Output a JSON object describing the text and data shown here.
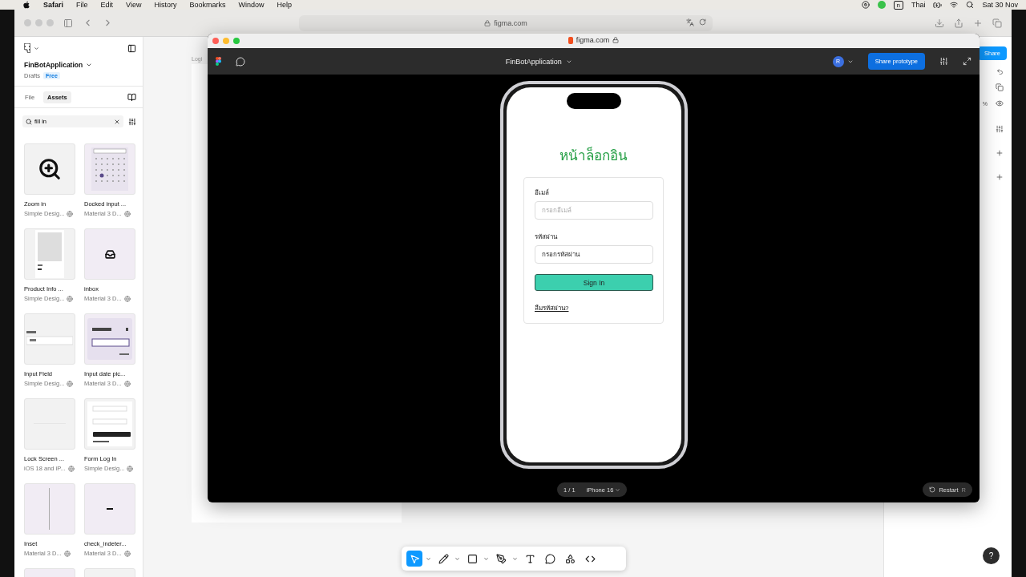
{
  "menubar": {
    "menus": [
      {
        "label": "Safari",
        "kind": "app"
      },
      {
        "label": "File",
        "kind": "menu"
      },
      {
        "label": "Edit",
        "kind": "menu"
      },
      {
        "label": "View",
        "kind": "menu"
      },
      {
        "label": "History",
        "kind": "menu"
      },
      {
        "label": "Bookmarks",
        "kind": "menu"
      },
      {
        "label": "Window",
        "kind": "menu"
      },
      {
        "label": "Help",
        "kind": "menu"
      }
    ],
    "input_source": "n",
    "language": "Thai",
    "clock": "Sat 30 Nov"
  },
  "browser": {
    "address": "figma.com"
  },
  "sidebar": {
    "file_name": "FinBotApplication",
    "location": "Drafts",
    "plan": "Free",
    "tabs": [
      {
        "label": "File",
        "selected": false
      },
      {
        "label": "Assets",
        "selected": true
      }
    ],
    "search": {
      "value": "fill in"
    },
    "assets": [
      {
        "name": "Zoom in",
        "library": "Simple Desig...",
        "kind": "zoom"
      },
      {
        "name": "Docked input ...",
        "library": "Material 3 D...",
        "kind": "calendar"
      },
      {
        "name": "Product Info ...",
        "library": "Simple Desig...",
        "kind": "product"
      },
      {
        "name": "inbox",
        "library": "Material 3 D...",
        "kind": "inbox"
      },
      {
        "name": "Input Field",
        "library": "Simple Desig...",
        "kind": "input"
      },
      {
        "name": "Input date pic...",
        "library": "Material 3 D...",
        "kind": "date"
      },
      {
        "name": "Lock Screen ...",
        "library": "iOS 18 and iP...",
        "kind": "lock"
      },
      {
        "name": "Form Log In",
        "library": "Simple Desig...",
        "kind": "form"
      },
      {
        "name": "Inset",
        "library": "Material 3 D...",
        "kind": "inset"
      },
      {
        "name": "check_indeter...",
        "library": "Material 3 D...",
        "kind": "dash"
      }
    ]
  },
  "canvas": {
    "frame_label": "Logi"
  },
  "right_panel": {
    "share": "Share",
    "zoom_unit": "%"
  },
  "prototype_window": {
    "title": "figma.com",
    "file_name": "FinBotApplication",
    "avatar": "R",
    "share": "Share prototype",
    "screen": {
      "heading": "หน้าล็อกอิน",
      "email_label": "อีเมล์",
      "email_placeholder": "กรอกอีเมล์",
      "password_label": "รหัสผ่าน",
      "password_value": "กรอกรหัสผ่าน",
      "sign_in": "Sign In",
      "forgot": "ลืมรหัสผ่าน?"
    },
    "page_counter": "1 / 1",
    "device": "iPhone 16",
    "restart": "Restart",
    "restart_key": "R"
  },
  "tools": [
    {
      "kind": "move",
      "selected": true,
      "menu": true
    },
    {
      "kind": "draw",
      "selected": false,
      "menu": true
    },
    {
      "kind": "frame",
      "selected": false,
      "menu": true
    },
    {
      "kind": "pen",
      "selected": false,
      "menu": true
    },
    {
      "kind": "text",
      "selected": false,
      "menu": false
    },
    {
      "kind": "comment",
      "selected": false,
      "menu": false
    },
    {
      "kind": "components",
      "selected": false,
      "menu": false
    },
    {
      "kind": "code",
      "selected": false,
      "menu": false
    }
  ],
  "help": "?"
}
